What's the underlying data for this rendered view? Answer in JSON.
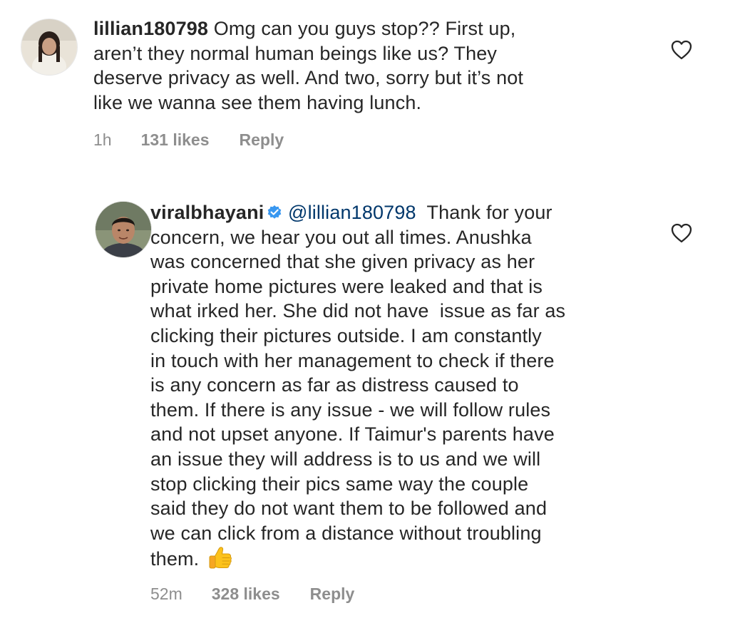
{
  "comments": [
    {
      "username": "lillian180798",
      "verified": false,
      "lines": [
        "Omg can you guys stop?? First up,",
        "aren’t they normal human beings like us? They",
        "deserve privacy as well. And two, sorry but it’s not",
        "like we wanna see them having lunch."
      ],
      "time": "1h",
      "likes": "131 likes",
      "reply_label": "Reply",
      "like_icon": "heart-outline-icon"
    },
    {
      "username": "viralbhayani",
      "verified": true,
      "mention": "@lillian180798",
      "lines": [
        "Thank for your",
        "concern, we hear you out all times. Anushka",
        "was concerned that she given privacy as her",
        "private home pictures were leaked and that is",
        "what irked her. She did not have  issue as far as",
        "clicking their pictures outside. I am constantly",
        "in touch with her management to check if there",
        "is any concern as far as distress caused to",
        "them. If there is any issue - we will follow rules",
        "and not upset anyone. If Taimur's parents have",
        "an issue they will address is to us and we will",
        "stop clicking their pics same way the couple",
        "said they do not want them to be followed and",
        "we can click from a distance without troubling",
        "them."
      ],
      "emoji": "thumbs-up-icon",
      "time": "52m",
      "likes": "328 likes",
      "reply_label": "Reply",
      "like_icon": "heart-outline-icon"
    }
  ],
  "colors": {
    "text": "#262626",
    "secondary": "#8e8e8e",
    "mention": "#00376b",
    "verified": "#3897f0"
  }
}
